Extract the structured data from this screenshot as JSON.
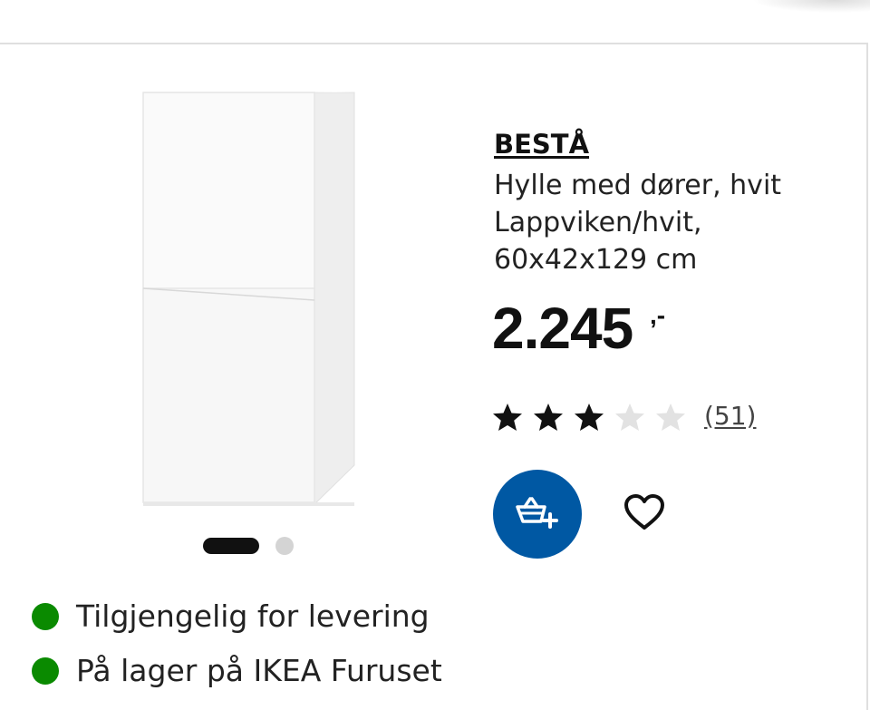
{
  "product": {
    "brand": "BESTÅ",
    "description_lines": [
      "Hylle med dører, hvit",
      "Lappviken/hvit,",
      "60x42x129 cm"
    ],
    "price": "2.245",
    "price_suffix": ",-",
    "rating": 3,
    "rating_max": 5,
    "review_count_label": "(51)"
  },
  "carousel": {
    "slide_count": 2,
    "active_index": 0
  },
  "actions": {
    "add_to_cart_icon": "basket-plus-icon",
    "favourite_icon": "heart-icon"
  },
  "availability": [
    {
      "text": "Tilgjengelig for levering",
      "status_color": "#0a8a00"
    },
    {
      "text": "På lager på IKEA Furuset",
      "status_color": "#0a8a00"
    }
  ],
  "colors": {
    "brand_blue": "#0058a3",
    "star_filled": "#111111",
    "star_empty": "#e2e2e2",
    "available_green": "#0a8a00"
  }
}
